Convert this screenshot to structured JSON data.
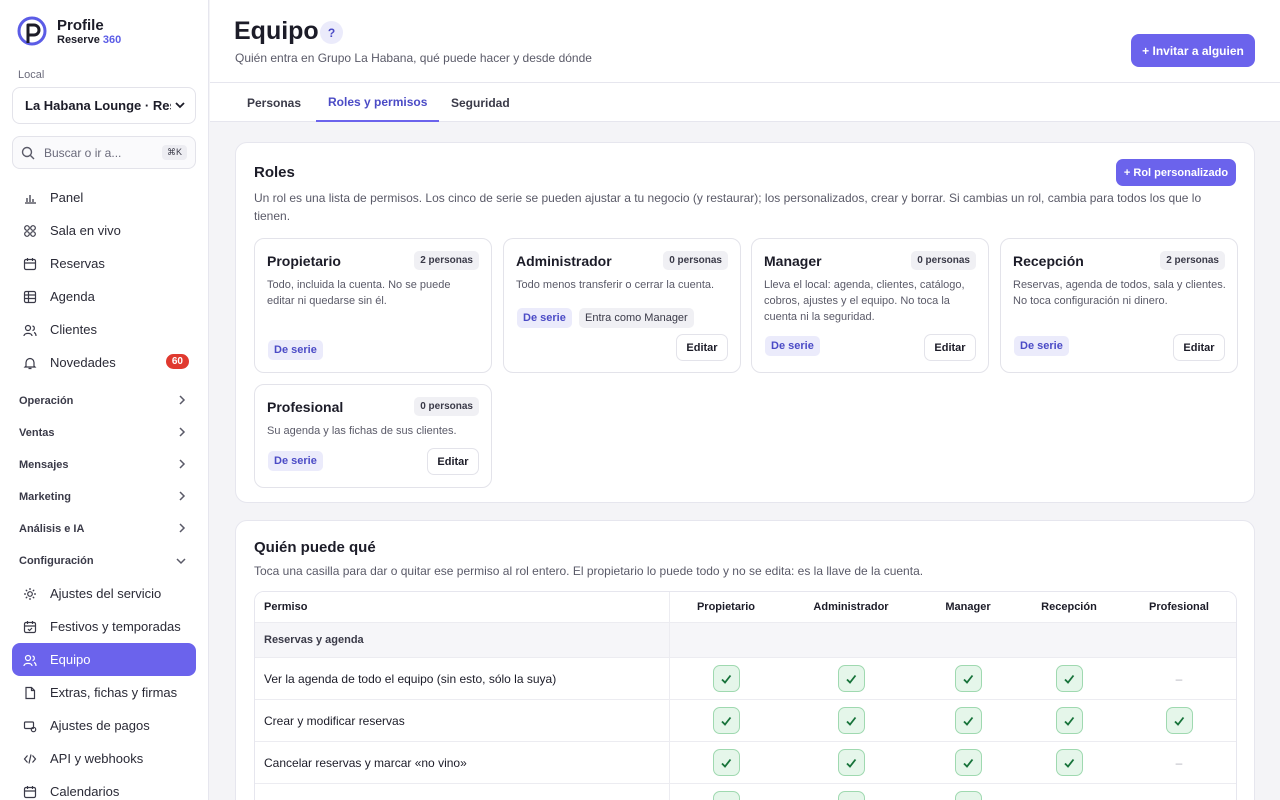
{
  "brand": {
    "name": "Profile",
    "sub_prefix": "Reserve ",
    "sub_accent": "360"
  },
  "sidebar": {
    "local_label": "Local",
    "local_value": "La Habana Lounge · Rest",
    "search_placeholder": "Buscar o ir a...",
    "search_shortcut": "⌘K",
    "items": [
      {
        "label": "Panel",
        "icon": "bar-chart-icon"
      },
      {
        "label": "Sala en vivo",
        "icon": "grid-icon"
      },
      {
        "label": "Reservas",
        "icon": "calendar-icon"
      },
      {
        "label": "Agenda",
        "icon": "agenda-icon"
      },
      {
        "label": "Clientes",
        "icon": "users-icon"
      },
      {
        "label": "Novedades",
        "icon": "bell-icon",
        "badge": "60"
      }
    ],
    "groups": [
      {
        "label": "Operación",
        "state": "collapsed"
      },
      {
        "label": "Ventas",
        "state": "collapsed"
      },
      {
        "label": "Mensajes",
        "state": "collapsed"
      },
      {
        "label": "Marketing",
        "state": "collapsed"
      },
      {
        "label": "Análisis e IA",
        "state": "collapsed"
      },
      {
        "label": "Configuración",
        "state": "expanded"
      }
    ],
    "config_items": [
      {
        "label": "Ajustes del servicio",
        "icon": "sun-icon"
      },
      {
        "label": "Festivos y temporadas",
        "icon": "calendar-check-icon"
      },
      {
        "label": "Equipo",
        "icon": "team-icon",
        "active": true
      },
      {
        "label": "Extras, fichas y firmas",
        "icon": "document-icon"
      },
      {
        "label": "Ajustes de pagos",
        "icon": "payment-icon"
      },
      {
        "label": "API y webhooks",
        "icon": "code-icon"
      },
      {
        "label": "Calendarios",
        "icon": "calendar-icon"
      }
    ]
  },
  "header": {
    "title": "Equipo",
    "help": "?",
    "subtitle": "Quién entra en Grupo La Habana, qué puede hacer y desde dónde",
    "invite_label": "+ Invitar a alguien"
  },
  "tabs": [
    {
      "label": "Personas"
    },
    {
      "label": "Roles y permisos",
      "active": true
    },
    {
      "label": "Seguridad"
    }
  ],
  "roles_panel": {
    "title": "Roles",
    "custom_label": "+ Rol personalizado",
    "description": "Un rol es una lista de permisos. Los cinco de serie se pueden ajustar a tu negocio (y restaurar); los personalizados, crear y borrar. Si cambias un rol, cambia para todos los que lo tienen.",
    "roles": [
      {
        "name": "Propietario",
        "count": "2 personas",
        "desc": "Todo, incluida la cuenta. No se puede editar ni quedarse sin él.",
        "chip": "De serie"
      },
      {
        "name": "Administrador",
        "count": "0 personas",
        "desc": "Todo menos transferir o cerrar la cuenta.",
        "chip": "De serie",
        "extra": "Entra como Manager",
        "edit": "Editar"
      },
      {
        "name": "Manager",
        "count": "0 personas",
        "desc": "Lleva el local: agenda, clientes, catálogo, cobros, ajustes y el equipo. No toca la cuenta ni la seguridad.",
        "chip": "De serie",
        "edit": "Editar"
      },
      {
        "name": "Recepción",
        "count": "2 personas",
        "desc": "Reservas, agenda de todos, sala y clientes. No toca configuración ni dinero.",
        "chip": "De serie",
        "edit": "Editar"
      },
      {
        "name": "Profesional",
        "count": "0 personas",
        "desc": "Su agenda y las fichas de sus clientes.",
        "chip": "De serie",
        "edit": "Editar"
      }
    ]
  },
  "perms_panel": {
    "title": "Quién puede qué",
    "description": "Toca una casilla para dar o quitar ese permiso al rol entero. El propietario lo puede todo y no se edita: es la llave de la cuenta.",
    "columns": [
      "Permiso",
      "Propietario",
      "Administrador",
      "Manager",
      "Recepción",
      "Profesional"
    ],
    "group": "Reservas y agenda",
    "rows": [
      {
        "label": "Ver la agenda de todo el equipo (sin esto, sólo la suya)",
        "values": [
          true,
          true,
          true,
          true,
          false
        ]
      },
      {
        "label": "Crear y modificar reservas",
        "values": [
          true,
          true,
          true,
          true,
          true
        ]
      },
      {
        "label": "Cancelar reservas y marcar «no vino»",
        "values": [
          true,
          true,
          true,
          true,
          false
        ]
      },
      {
        "label": "",
        "values": [
          true,
          true,
          true,
          false,
          false
        ]
      }
    ],
    "dash": "–"
  }
}
